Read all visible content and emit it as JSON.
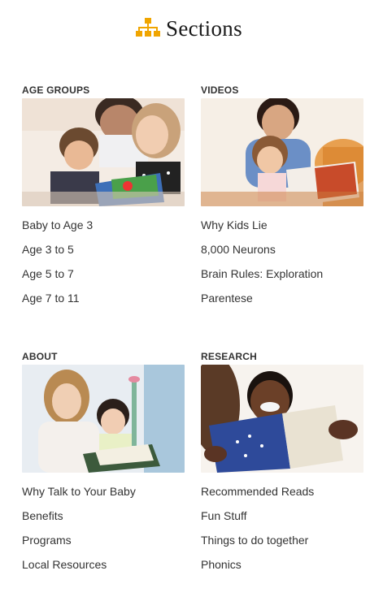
{
  "header": {
    "title": "Sections",
    "icon": "sitemap-icon",
    "icon_color": "#f0a500"
  },
  "sections": [
    {
      "title": "AGE GROUPS",
      "image": "parent-child-reading-photo",
      "links": [
        "Baby to Age 3",
        "Age 3 to 5",
        "Age 5 to 7",
        "Age 7 to 11"
      ]
    },
    {
      "title": "VIDEOS",
      "image": "mother-daughter-reading-photo",
      "links": [
        "Why Kids Lie",
        "8,000 Neurons",
        "Brain Rules: Exploration",
        "Parentese"
      ]
    },
    {
      "title": "ABOUT",
      "image": "mother-baby-reading-photo",
      "links": [
        "Why Talk to Your Baby",
        "Benefits",
        "Programs",
        "Local Resources"
      ]
    },
    {
      "title": "RESEARCH",
      "image": "boy-reading-book-photo",
      "links": [
        "Recommended Reads",
        "Fun Stuff",
        "Things to do together",
        "Phonics"
      ]
    }
  ]
}
